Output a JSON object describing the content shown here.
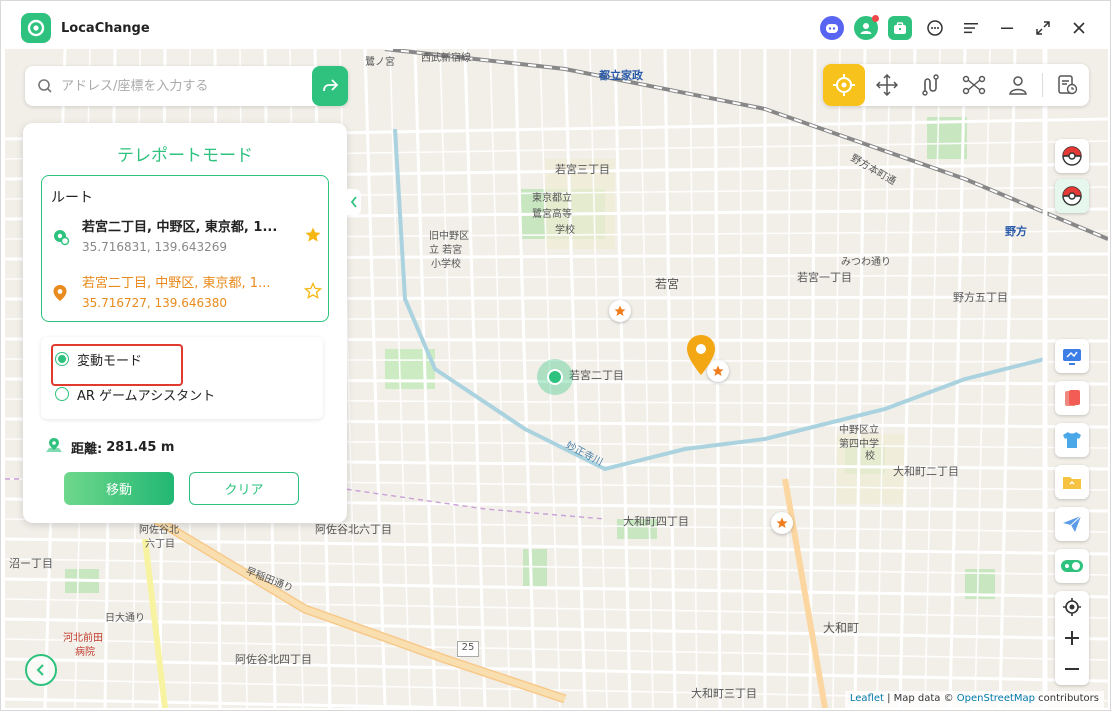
{
  "app": {
    "title": "LocaChange"
  },
  "search": {
    "placeholder": "アドレス/座標を入力する"
  },
  "panel": {
    "title": "テレポートモード",
    "route_label": "ルート",
    "origin": {
      "address": "若宮二丁目, 中野区, 東京都, 1...",
      "coords": "35.716831, 139.643269"
    },
    "destination": {
      "address": "若宮二丁目, 中野区, 東京都, 1...",
      "coords": "35.716727, 139.646380"
    },
    "options": [
      {
        "label": "変動モード",
        "selected": true
      },
      {
        "label": "AR ゲームアシスタント",
        "selected": false
      }
    ],
    "distance_label": "距離:",
    "distance_value": "281.45 m",
    "move_label": "移動",
    "clear_label": "クリア"
  },
  "map": {
    "labels": [
      {
        "text": "若宮三丁目"
      },
      {
        "text": "東京都立"
      },
      {
        "text": "鷺宮高等"
      },
      {
        "text": "学校"
      },
      {
        "text": "旧中野区"
      },
      {
        "text": "立 若宮"
      },
      {
        "text": "小学校"
      },
      {
        "text": "若宮"
      },
      {
        "text": "若宮二丁目"
      },
      {
        "text": "若宮一丁目"
      },
      {
        "text": "みつわ通り"
      },
      {
        "text": "野方五丁目"
      },
      {
        "text": "野方"
      },
      {
        "text": "都立家政"
      },
      {
        "text": "西武新宿線"
      },
      {
        "text": "中野区立"
      },
      {
        "text": "第四中学"
      },
      {
        "text": "校"
      },
      {
        "text": "大和町二丁目"
      },
      {
        "text": "大和町四丁目"
      },
      {
        "text": "阿佐谷北六丁目"
      },
      {
        "text": "阿佐谷北"
      },
      {
        "text": "六丁目"
      },
      {
        "text": "早稲田通り"
      },
      {
        "text": "日大通り"
      },
      {
        "text": "河北前田"
      },
      {
        "text": "病院"
      },
      {
        "text": "阿佐谷北四丁目"
      },
      {
        "text": "大和町"
      },
      {
        "text": "大和町三丁目"
      },
      {
        "text": "沼ー丁目"
      },
      {
        "text": "25"
      },
      {
        "text": "妙正寺川"
      },
      {
        "text": "野方本町通"
      },
      {
        "text": "鷺ノ宮"
      }
    ]
  },
  "attribution": {
    "leaflet": "Leaflet",
    "sep": " | Map data © ",
    "osm": "OpenStreetMap",
    "suffix": " contributors"
  },
  "colors": {
    "accent": "#2ec27e",
    "destination": "#e98a1c",
    "active_mode": "#f8c21c",
    "highlight": "#e03a2e"
  }
}
